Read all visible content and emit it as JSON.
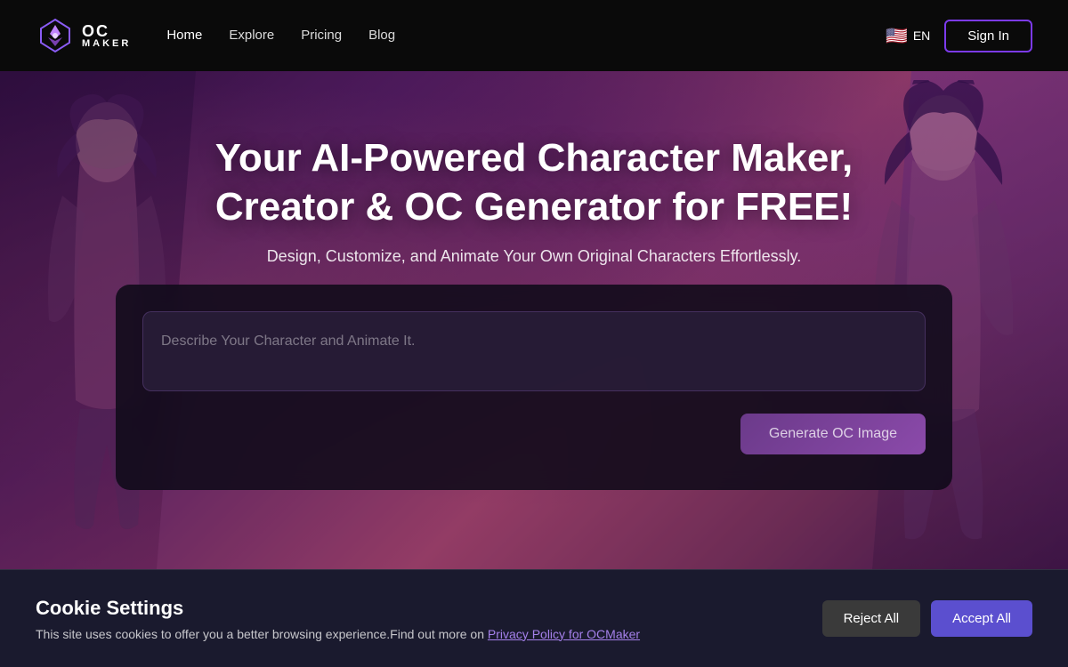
{
  "nav": {
    "logo_oc": "OC",
    "logo_maker": "MAKER",
    "links": [
      {
        "label": "Home",
        "active": true
      },
      {
        "label": "Explore",
        "active": false
      },
      {
        "label": "Pricing",
        "active": false
      },
      {
        "label": "Blog",
        "active": false
      }
    ],
    "lang": "EN",
    "sign_in": "Sign In"
  },
  "hero": {
    "title_line1": "Your AI-Powered Character Maker,",
    "title_line2": "Creator & OC Generator for FREE!",
    "subtitle": "Design, Customize, and Animate Your Own Original Characters Effortlessly."
  },
  "card": {
    "textarea_placeholder": "Describe Your Character and Animate It.",
    "generate_button": "Generate OC Image"
  },
  "cookie": {
    "title": "Cookie Settings",
    "description": "This site uses cookies to offer you a better browsing experience.Find out more on ",
    "link_text": "Privacy Policy for OCMaker",
    "reject_label": "Reject All",
    "accept_label": "Accept All"
  }
}
